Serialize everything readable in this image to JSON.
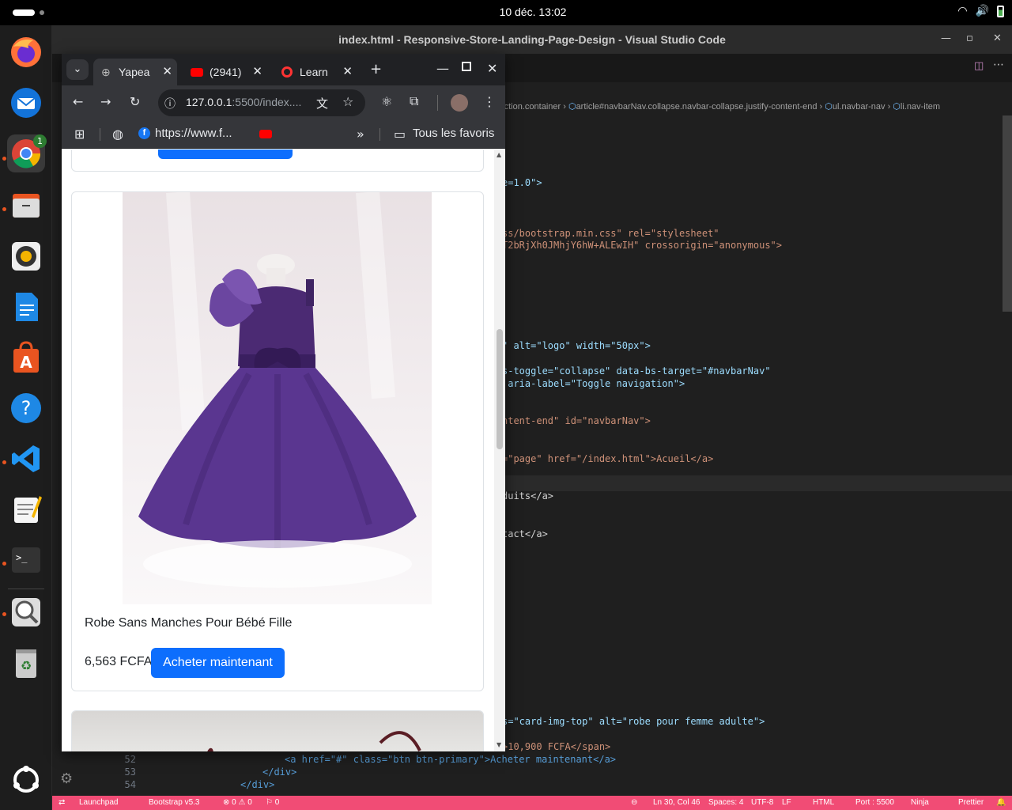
{
  "system": {
    "clock": "10 déc.  13:02"
  },
  "dock": {
    "updates_badge": "1"
  },
  "vscode": {
    "title": "index.html - Responsive-Store-Landing-Page-Design - Visual Studio Code",
    "breadcrumbs": [
      "section.container",
      "article#navbarNav.collapse.navbar-collapse.justify-content-end",
      "ul.navbar-nav",
      "li.nav-item"
    ],
    "code_lines": [
      "e=1.0\">",
      "ss/bootstrap.min.css\" rel=\"stylesheet\"",
      "T2bRjXh0JMhjY6hW+ALEwIH\" crossorigin=\"anonymous\">",
      "\" alt=\"logo\" width=\"50px\">",
      "s-toggle=\"collapse\" data-bs-target=\"#navbarNav\"",
      " aria-label=\"Toggle navigation\">",
      "ntent-end\" id=\"navbarNav\">",
      "=\"page\" href=\"/index.html\">Acueil</a>",
      "duits</a>",
      "tact</a>",
      "s=\"card-img-top\" alt=\"robe pour femme adulte\">",
      ">10,900 FCFA</span>"
    ],
    "bottom_lines": [
      {
        "n": "52",
        "text": "<a href=\"#\" class=\"btn btn-primary\">Acheter maintenant</a>"
      },
      {
        "n": "53",
        "text": "</div>"
      },
      {
        "n": "54",
        "text": "</div>"
      }
    ],
    "status": {
      "launchpad": "Launchpad",
      "bootstrap": "Bootstrap v5.3",
      "problems": "⊗ 0 ⚠ 0",
      "ports": "⚐ 0",
      "position": "Ln 30, Col 46",
      "spaces": "Spaces: 4",
      "encoding": "UTF-8",
      "eol": "LF",
      "language": "HTML",
      "port": "Port : 5500",
      "ninja": "Ninja",
      "prettier": "Prettier"
    }
  },
  "browser": {
    "tabs": [
      {
        "label": "Yapea",
        "active": true
      },
      {
        "label": "(2941)",
        "active": false
      },
      {
        "label": "Learn",
        "active": false
      }
    ],
    "url_host": "127.0.0.1",
    "url_path": ":5500/index....",
    "bookmarks": {
      "facebook": "https://www.f...",
      "all": "Tous les favoris"
    },
    "product": {
      "title": "Robe Sans Manches Pour Bébé Fille",
      "price": "6,563 FCFA",
      "button": "Acheter maintenant"
    }
  }
}
